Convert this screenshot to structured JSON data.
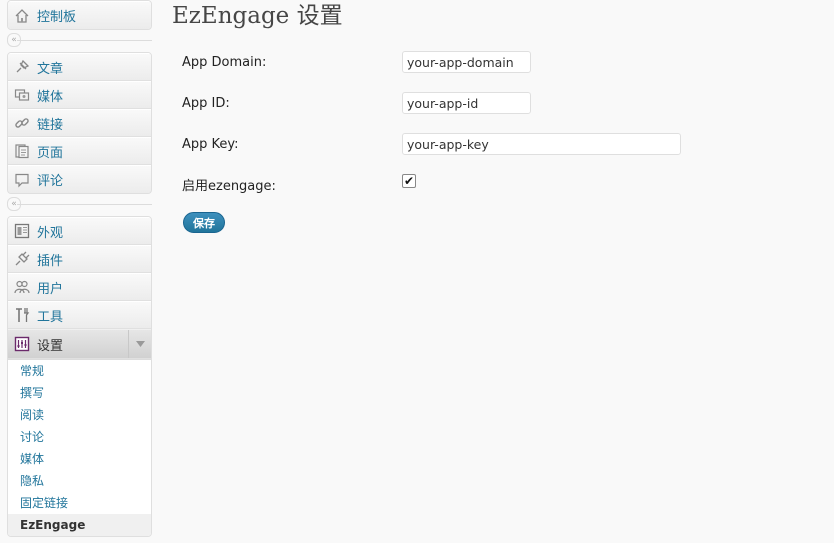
{
  "sidebar": {
    "dashboard": {
      "label": "控制板",
      "icon": "dashboard-icon"
    },
    "content_items": [
      {
        "label": "文章",
        "icon": "pushpin-icon"
      },
      {
        "label": "媒体",
        "icon": "media-icon"
      },
      {
        "label": "链接",
        "icon": "link-icon"
      },
      {
        "label": "页面",
        "icon": "page-icon"
      },
      {
        "label": "评论",
        "icon": "comment-icon"
      }
    ],
    "admin_items": [
      {
        "label": "外观",
        "icon": "appearance-icon"
      },
      {
        "label": "插件",
        "icon": "plugin-icon"
      },
      {
        "label": "用户",
        "icon": "users-icon"
      },
      {
        "label": "工具",
        "icon": "tools-icon"
      }
    ],
    "settings": {
      "label": "设置",
      "icon": "settings-icon",
      "submenu": [
        "常规",
        "撰写",
        "阅读",
        "讨论",
        "媒体",
        "隐私",
        "固定链接",
        "EzEngage"
      ],
      "current": "EzEngage"
    },
    "collapse_glyph": "«"
  },
  "main": {
    "title": "EzEngage 设置",
    "fields": {
      "domain": {
        "label": "App Domain:",
        "value": "your-app-domain"
      },
      "app_id": {
        "label": "App ID:",
        "value": "your-app-id"
      },
      "app_key": {
        "label": "App Key:",
        "value": "your-app-key"
      },
      "enable": {
        "label": "启用ezengage:",
        "checked": true,
        "check_glyph": "✔"
      }
    },
    "save_label": "保存"
  },
  "colors": {
    "link": "#21759b",
    "button": "#21759b",
    "background": "#f9f9f9"
  }
}
